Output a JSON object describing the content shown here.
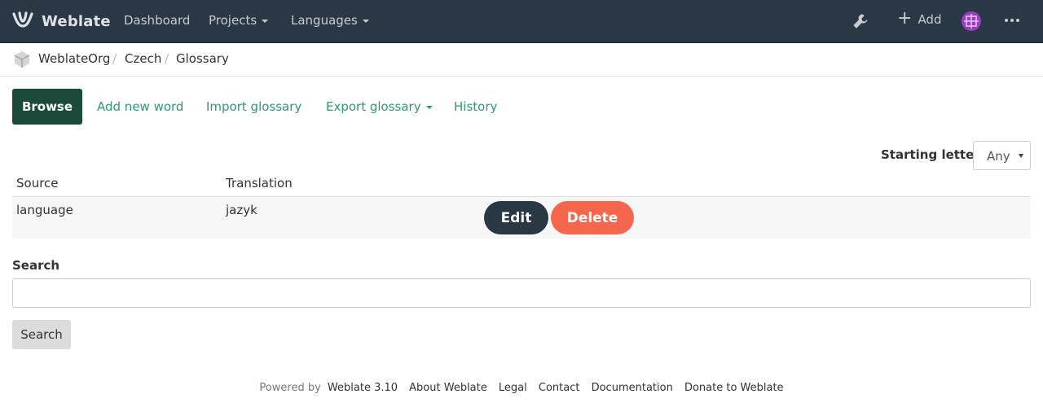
{
  "navbar": {
    "brand": "Weblate",
    "items": [
      "Dashboard",
      "Projects",
      "Languages"
    ],
    "add_label": "Add",
    "icons": [
      "weblate-logo-icon",
      "wrench-icon",
      "plus-icon",
      "avatar",
      "more-icon"
    ]
  },
  "breadcrumb": {
    "items": [
      "WeblateOrg",
      "Czech",
      "Glossary"
    ],
    "separator": "/"
  },
  "tabs": {
    "active": "Browse",
    "items": [
      "Add new word",
      "Import glossary",
      "Export glossary",
      "History"
    ]
  },
  "filter": {
    "label": "Starting letter",
    "selected": "Any"
  },
  "table": {
    "headers": [
      "Source",
      "Translation"
    ],
    "rows": [
      {
        "source": "language",
        "translation": "jazyk"
      }
    ],
    "edit_label": "Edit",
    "delete_label": "Delete"
  },
  "search": {
    "label": "Search",
    "button": "Search"
  },
  "footer": {
    "powered_by": "Powered by",
    "version": "Weblate 3.10",
    "links": [
      "About Weblate",
      "Legal",
      "Contact",
      "Documentation",
      "Donate to Weblate"
    ]
  },
  "colors": {
    "navbar_bg": "#2a3744",
    "accent_green": "#1b4a3a",
    "link_green": "#2f9a6e",
    "delete_red": "#f6664c"
  }
}
